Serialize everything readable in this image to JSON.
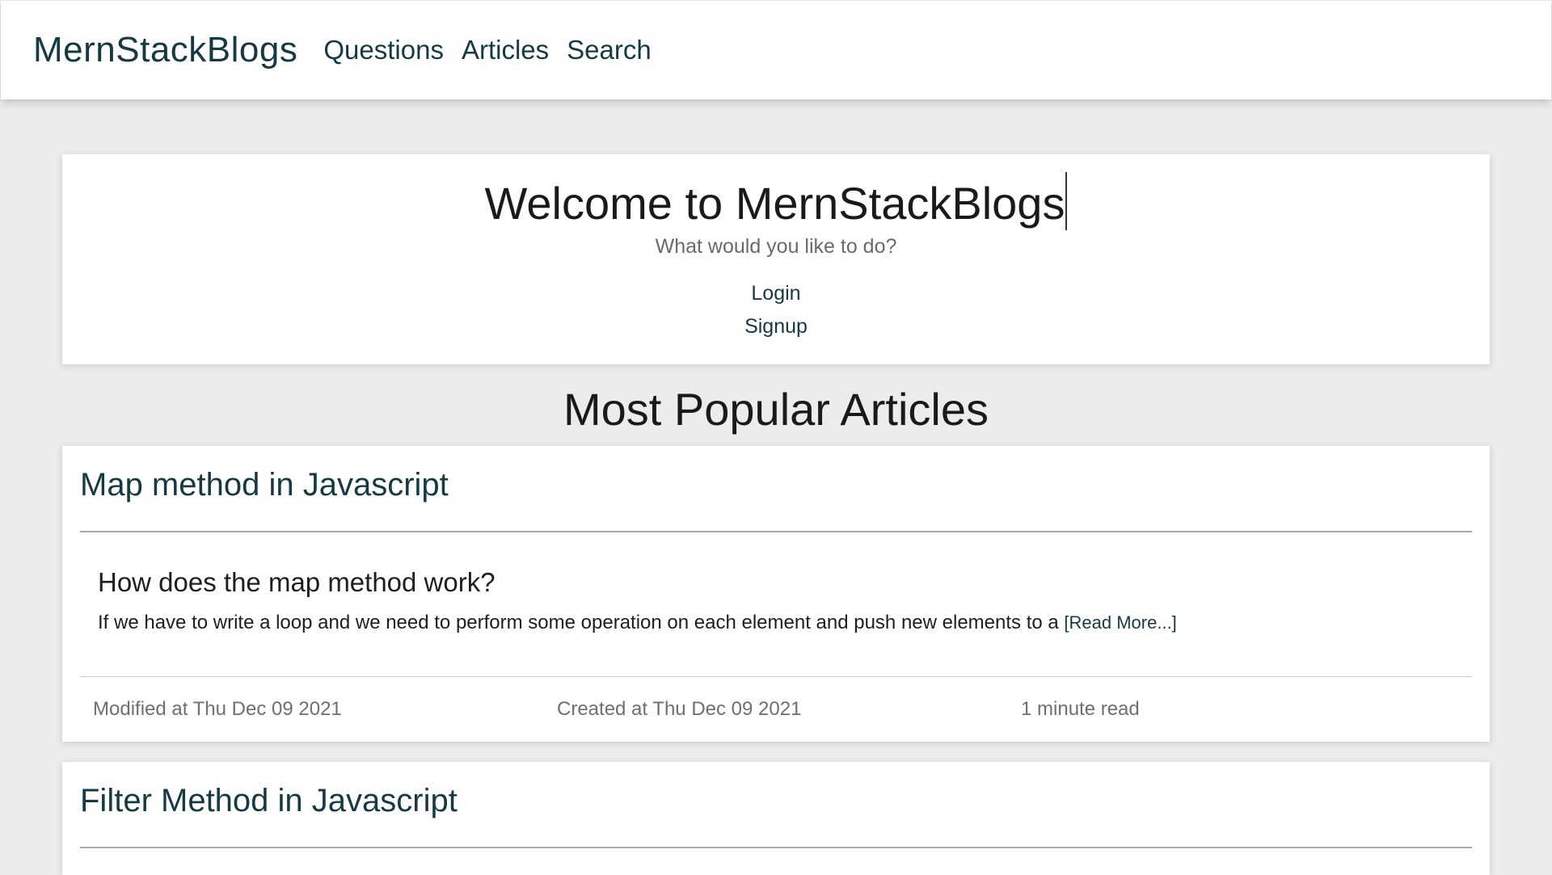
{
  "nav": {
    "brand": "MernStackBlogs",
    "links": [
      "Questions",
      "Articles",
      "Search"
    ]
  },
  "welcome": {
    "title": "Welcome to MernStackBlogs",
    "subtitle": "What would you like to do?",
    "login_label": "Login",
    "signup_label": "Signup"
  },
  "popular": {
    "heading": "Most Popular Articles",
    "articles": [
      {
        "title": "Map method in Javascript",
        "question": "How does the map method work?",
        "excerpt": "If we have to write a loop and we need to perform some operation on each element and push new elements to a",
        "read_more": "[Read More...]",
        "modified": "Modified at Thu Dec 09 2021",
        "created": "Created at Thu Dec 09 2021",
        "read_time": "1 minute read"
      },
      {
        "title": "Filter Method in Javascript"
      }
    ]
  },
  "colors": {
    "accent": "#163a44",
    "background": "#ececec",
    "card": "#ffffff"
  }
}
